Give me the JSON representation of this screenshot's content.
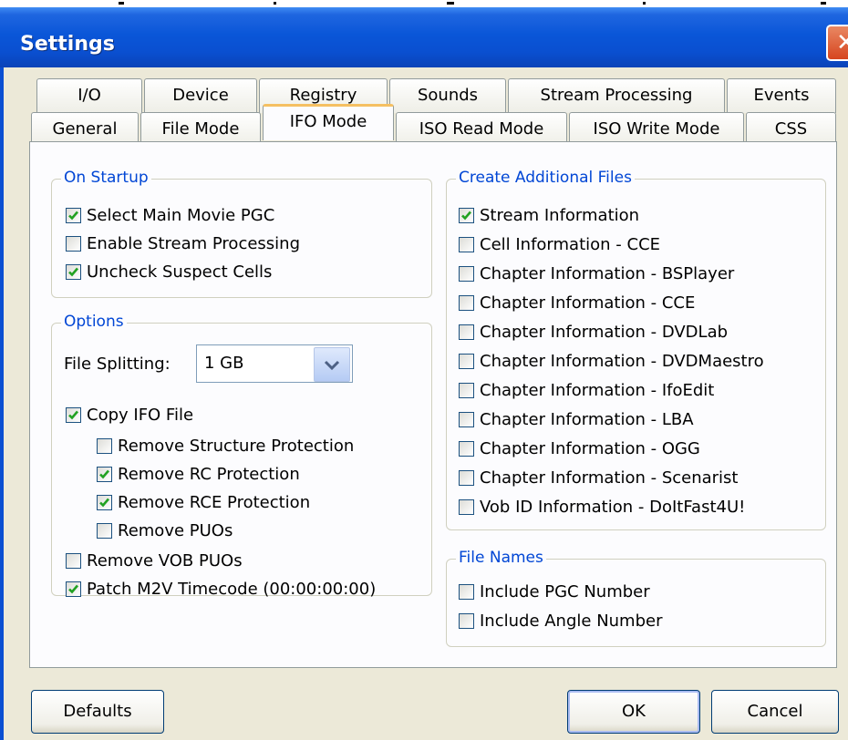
{
  "window": {
    "title": "Settings",
    "close_glyph": "✕"
  },
  "tabs_back": [
    "I/O",
    "Device",
    "Registry",
    "Sounds",
    "Stream Processing",
    "Events"
  ],
  "tabs_front": [
    "General",
    "File Mode",
    "IFO Mode",
    "ISO Read Mode",
    "ISO Write Mode",
    "CSS"
  ],
  "active_tab": "IFO Mode",
  "on_startup": {
    "title": "On Startup",
    "items": [
      {
        "label": "Select Main Movie PGC",
        "checked": true
      },
      {
        "label": "Enable Stream Processing",
        "checked": false
      },
      {
        "label": "Uncheck Suspect Cells",
        "checked": true
      }
    ]
  },
  "options": {
    "title": "Options",
    "file_splitting_label": "File Splitting:",
    "file_splitting_value": "1 GB",
    "items": [
      {
        "label": "Copy IFO File",
        "checked": true
      },
      {
        "label": "Remove Structure Protection",
        "checked": false
      },
      {
        "label": "Remove RC Protection",
        "checked": true
      },
      {
        "label": "Remove RCE Protection",
        "checked": true
      },
      {
        "label": "Remove PUOs",
        "checked": false
      },
      {
        "label": "Remove VOB PUOs",
        "checked": false
      },
      {
        "label": "Patch M2V Timecode (00:00:00:00)",
        "checked": true
      }
    ]
  },
  "create_files": {
    "title": "Create Additional Files",
    "items": [
      {
        "label": "Stream Information",
        "checked": true
      },
      {
        "label": "Cell Information - CCE",
        "checked": false
      },
      {
        "label": "Chapter Information - BSPlayer",
        "checked": false
      },
      {
        "label": "Chapter Information - CCE",
        "checked": false
      },
      {
        "label": "Chapter Information - DVDLab",
        "checked": false
      },
      {
        "label": "Chapter Information - DVDMaestro",
        "checked": false
      },
      {
        "label": "Chapter Information - IfoEdit",
        "checked": false
      },
      {
        "label": "Chapter Information - LBA",
        "checked": false
      },
      {
        "label": "Chapter Information - OGG",
        "checked": false
      },
      {
        "label": "Chapter Information - Scenarist",
        "checked": false
      },
      {
        "label": "Vob ID Information - DoItFast4U!",
        "checked": false
      }
    ]
  },
  "file_names": {
    "title": "File Names",
    "items": [
      {
        "label": "Include PGC Number",
        "checked": false
      },
      {
        "label": "Include Angle Number",
        "checked": false
      }
    ]
  },
  "buttons": {
    "defaults": "Defaults",
    "ok": "OK",
    "cancel": "Cancel"
  },
  "colors": {
    "titlebar": "#0a56d8",
    "group_title": "#0046d5",
    "checkmark": "#21a121",
    "active_tab_accent": "#f5c062"
  },
  "icons": {
    "check": "checkmark-icon",
    "dropdown": "chevron-down-icon",
    "close": "close-icon"
  }
}
